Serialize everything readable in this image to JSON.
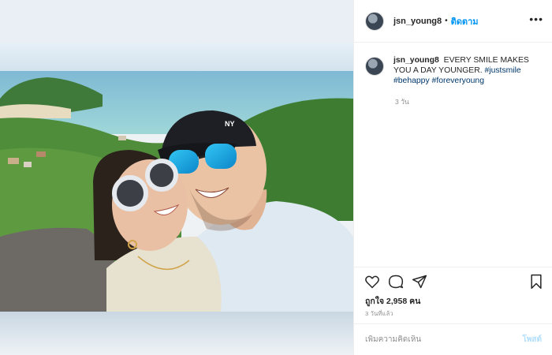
{
  "post": {
    "username": "jsn_young8",
    "follow_label": "ติดตาม",
    "dot": "•",
    "more_icon": "more-horizontal-icon",
    "more_glyph": "•••"
  },
  "caption": {
    "username": "jsn_young8",
    "text": "EVERY SMILE MAKES YOU A DAY YOUNGER.",
    "hashtags": [
      "#justsmile",
      "#behappy",
      "#foreveryoung"
    ],
    "time": "3 วัน"
  },
  "actions": {
    "icons": [
      "heart-icon",
      "comment-icon",
      "share-icon",
      "bookmark-icon"
    ],
    "likes": "ถูกใจ 2,958 คน",
    "posted_ago": "3 วันที่แล้ว"
  },
  "comment": {
    "placeholder": "เพิ่มความคิดเห็น",
    "post_label": "โพสต์"
  },
  "colors": {
    "accent": "#0095f6",
    "hashtag": "#00376b",
    "post_disabled": "#b2dffc",
    "muted": "#8e8e8e"
  }
}
